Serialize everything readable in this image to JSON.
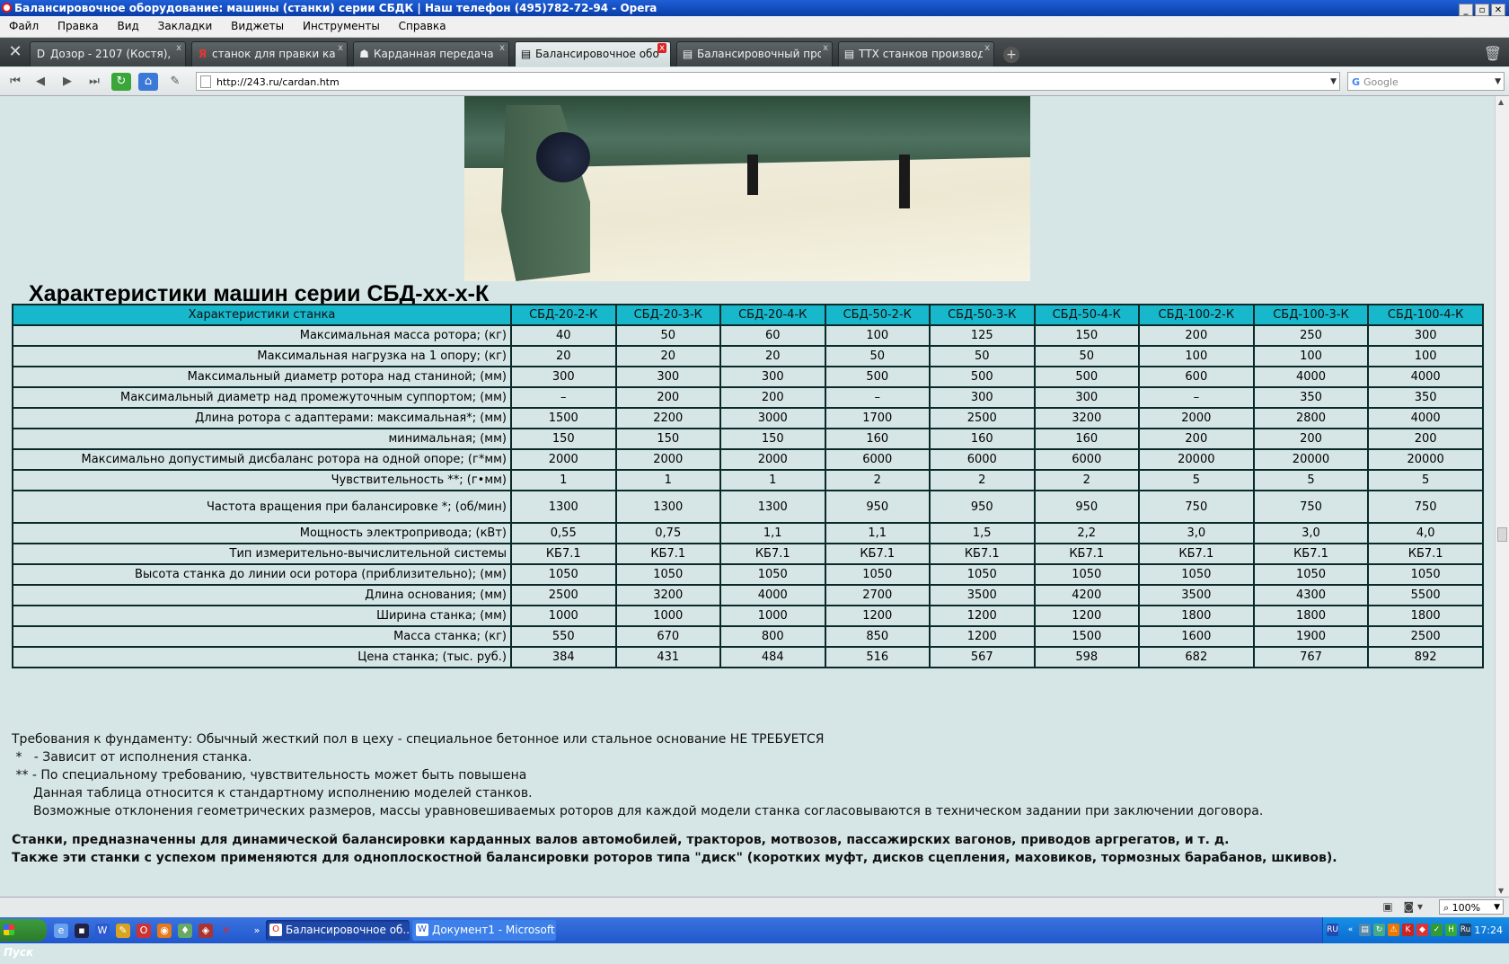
{
  "window": {
    "title": "Балансировочное оборудование: машины (станки) серии СБДК | Наш телефон (495)782-72-94 - Opera"
  },
  "menu": [
    "Файл",
    "Правка",
    "Вид",
    "Закладки",
    "Виджеты",
    "Инструменты",
    "Справка"
  ],
  "tabs": [
    {
      "label": "Дозор - 2107 (Костя), ...",
      "icon": "D"
    },
    {
      "label": "станок для правки кар...",
      "icon": "Я"
    },
    {
      "label": "Карданная передача (...",
      "icon": "☗"
    },
    {
      "label": "Балансировочное обор...",
      "icon": "▤",
      "active": true
    },
    {
      "label": "Балансировочный прог...",
      "icon": "▤"
    },
    {
      "label": "ТТХ станков производ...",
      "icon": "▤"
    }
  ],
  "address": {
    "url": "http://243.ru/cardan.htm",
    "search_placeholder": "Google"
  },
  "page": {
    "heading": "Характеристики машин серии СБД-хх-х-К",
    "table": {
      "header": [
        "Характеристики станка",
        "СБД-20-2-К",
        "СБД-20-3-К",
        "СБД-20-4-К",
        "СБД-50-2-К",
        "СБД-50-3-К",
        "СБД-50-4-К",
        "СБД-100-2-К",
        "СБД-100-3-К",
        "СБД-100-4-К"
      ],
      "rows": [
        {
          "label": "Максимальная масса ротора; (кг)",
          "values": [
            "40",
            "50",
            "60",
            "100",
            "125",
            "150",
            "200",
            "250",
            "300"
          ]
        },
        {
          "label": "Максимальная нагрузка на 1 опору; (кг)",
          "values": [
            "20",
            "20",
            "20",
            "50",
            "50",
            "50",
            "100",
            "100",
            "100"
          ]
        },
        {
          "label": "Максимальный диаметр ротора над станиной; (мм)",
          "values": [
            "300",
            "300",
            "300",
            "500",
            "500",
            "500",
            "600",
            "4000",
            "4000"
          ]
        },
        {
          "label": "Максимальный диаметр над промежуточным суппортом; (мм)",
          "values": [
            "–",
            "200",
            "200",
            "–",
            "300",
            "300",
            "–",
            "350",
            "350"
          ]
        },
        {
          "label": "Длина ротора с адаптерами: максимальная*; (мм)",
          "values": [
            "1500",
            "2200",
            "3000",
            "1700",
            "2500",
            "3200",
            "2000",
            "2800",
            "4000"
          ]
        },
        {
          "label": "минимальная; (мм)",
          "values": [
            "150",
            "150",
            "150",
            "160",
            "160",
            "160",
            "200",
            "200",
            "200"
          ]
        },
        {
          "label": "Максимально допустимый дисбаланс ротора на одной опоре; (г*мм)",
          "values": [
            "2000",
            "2000",
            "2000",
            "6000",
            "6000",
            "6000",
            "20000",
            "20000",
            "20000"
          ]
        },
        {
          "label": "Чувствительность **; (г•мм)",
          "values": [
            "1",
            "1",
            "1",
            "2",
            "2",
            "2",
            "5",
            "5",
            "5"
          ]
        },
        {
          "label": "Частота вращения при балансировке *; (об/мин)",
          "values": [
            "1300",
            "1300",
            "1300",
            "950",
            "950",
            "950",
            "750",
            "750",
            "750"
          ],
          "tall": true
        },
        {
          "label": "Мощность электропривода; (кВт)",
          "values": [
            "0,55",
            "0,75",
            "1,1",
            "1,1",
            "1,5",
            "2,2",
            "3,0",
            "3,0",
            "4,0"
          ]
        },
        {
          "label": "Тип измерительно-вычислительной системы",
          "values": [
            "КБ7.1",
            "КБ7.1",
            "КБ7.1",
            "КБ7.1",
            "КБ7.1",
            "КБ7.1",
            "КБ7.1",
            "КБ7.1",
            "КБ7.1"
          ]
        },
        {
          "label": "Высота станка до линии оси ротора (приблизительно); (мм)",
          "values": [
            "1050",
            "1050",
            "1050",
            "1050",
            "1050",
            "1050",
            "1050",
            "1050",
            "1050"
          ]
        },
        {
          "label": "Длина основания; (мм)",
          "values": [
            "2500",
            "3200",
            "4000",
            "2700",
            "3500",
            "4200",
            "3500",
            "4300",
            "5500"
          ]
        },
        {
          "label": "Ширина станка; (мм)",
          "values": [
            "1000",
            "1000",
            "1000",
            "1200",
            "1200",
            "1200",
            "1800",
            "1800",
            "1800"
          ]
        },
        {
          "label": "Масса станка; (кг)",
          "values": [
            "550",
            "670",
            "800",
            "850",
            "1200",
            "1500",
            "1600",
            "1900",
            "2500"
          ]
        },
        {
          "label": "Цена станка; (тыс. руб.)",
          "values": [
            "384",
            "431",
            "484",
            "516",
            "567",
            "598",
            "682",
            "767",
            "892"
          ]
        }
      ]
    },
    "notes": [
      "Требования к фундаменту: Обычный жесткий пол в цеху - специальное бетонное или стальное основание НЕ ТРЕБУЕТСЯ",
      " *   - Зависит от исполнения станка.",
      " ** - По специальному требованию, чувствительность может быть повышена"
    ],
    "notes_indented": [
      "Данная таблица относится к стандартному исполнению моделей станков.",
      "Возможные отклонения геометрических размеров, массы уравновешиваемых роторов для каждой модели станка согласовываются в техническом задании при заключении договора."
    ],
    "bold_notes": [
      "Станки, предназначенны для динамической балансировки карданных валов автомобилей, тракторов, мотвозов, пассажирских вагонов, приводов аргрегатов, и т. д.",
      "Также эти станки с успехом применяются для одноплоскостной балансировки роторов типа \"диск\" (коротких муфт, дисков сцепления, маховиков, тормозных барабанов, шкивов)."
    ]
  },
  "status": {
    "zoom": "100%"
  },
  "taskbar": {
    "start": "Пуск",
    "tasks": [
      {
        "label": "Балансировочное об...",
        "active": true
      },
      {
        "label": "Документ1 - Microsoft ...",
        "active": false
      }
    ],
    "lang": "RU",
    "clock": "17:24"
  }
}
